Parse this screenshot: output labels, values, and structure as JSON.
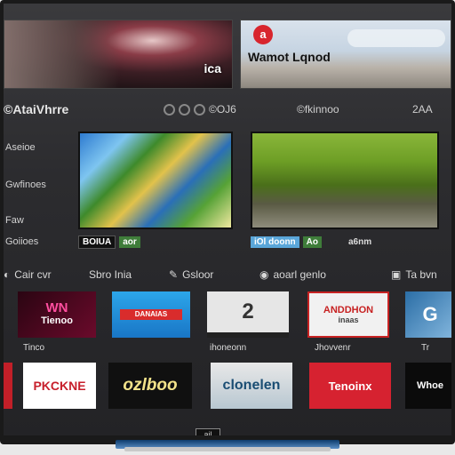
{
  "banners": {
    "left_logo": "ica",
    "right_headline": "Wamot Lqnod",
    "right_badge": "a"
  },
  "menu": {
    "title": "©AtaiVhrre",
    "dots_label": "©OJ6",
    "center_label": "©fkinnoo",
    "right_label": "2AA"
  },
  "sidebar": {
    "items": [
      "Aseioe",
      "Gwfinoes",
      "Faw",
      "Goiioes"
    ]
  },
  "tiles": {
    "a_caption": "BOIUA",
    "a_badge": "aor",
    "b_caption": "iOl doonn",
    "b_badge": "Ao",
    "b_right": "a6nm"
  },
  "categories": [
    {
      "icon": "a",
      "label": "Cair cvr"
    },
    {
      "icon": "b",
      "label": "Sbro Inia"
    },
    {
      "icon": "e",
      "label": "Gsloor"
    },
    {
      "icon": "o",
      "label": "aoarl genlo"
    },
    {
      "icon": "b",
      "label": "Ta bvn"
    }
  ],
  "channels_row1": [
    {
      "name": "WN",
      "sub": "Tienoo"
    },
    {
      "name": "",
      "bar": "DANAIAS"
    },
    {
      "name": "2"
    },
    {
      "name": "ANDDHON",
      "sub": "inaas"
    },
    {
      "name": "G"
    }
  ],
  "labels_row1": [
    "Tinco",
    "",
    "ihoneonn",
    "Jhovvenr",
    "Tr"
  ],
  "channels_row2": [
    {
      "name": ""
    },
    {
      "name": "PKCKNE"
    },
    {
      "name": "ozlboo"
    },
    {
      "name": "clonelen"
    },
    {
      "name": "Tenoinx"
    },
    {
      "name": "Whoe"
    }
  ],
  "stand_badge": "ail"
}
